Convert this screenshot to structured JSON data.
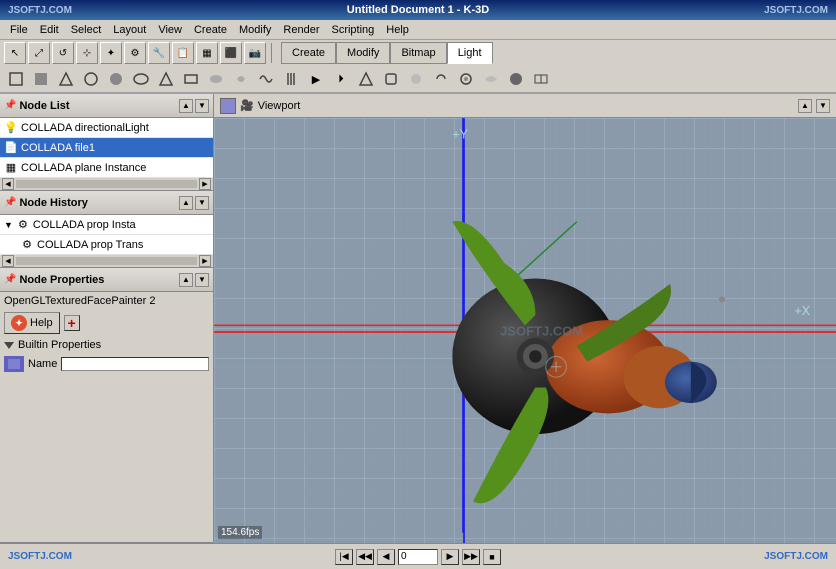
{
  "titlebar": {
    "logo_left": "JSOFTJ.COM",
    "title": "Untitled Document 1 - K-3D",
    "logo_right": "JSOFTJ.COM"
  },
  "menubar": {
    "items": [
      "File",
      "Edit",
      "Select",
      "Layout",
      "View",
      "Create",
      "Modify",
      "Render",
      "Scripting",
      "Help"
    ]
  },
  "toolbar": {
    "tabs": [
      "Create",
      "Modify",
      "Bitmap",
      "Light"
    ],
    "active_tab": "Light"
  },
  "left_panel": {
    "node_list": {
      "header": "Node List",
      "items": [
        {
          "label": "COLLADA directionalLight",
          "selected": false
        },
        {
          "label": "COLLADA file1",
          "selected": true
        },
        {
          "label": "COLLADA plane Instance",
          "selected": false
        }
      ]
    },
    "node_history": {
      "header": "Node History",
      "items": [
        {
          "label": "COLLADA prop Insta",
          "selected": false
        },
        {
          "label": "COLLADA prop Trans",
          "selected": false
        }
      ]
    },
    "node_properties": {
      "header": "Node Properties",
      "painter_label": "OpenGLTexturedFacePainter 2",
      "help_btn": "Help",
      "builtin_label": "Builtin Properties",
      "name_label": "Name"
    }
  },
  "viewport": {
    "header": "Viewport",
    "fps": "154.6fps",
    "watermark": "JSOFTJ.COM"
  },
  "statusbar": {
    "logo": "JSOFTJ.COM",
    "logo_right": "JSOFTJ.COM",
    "frame_value": "0"
  }
}
